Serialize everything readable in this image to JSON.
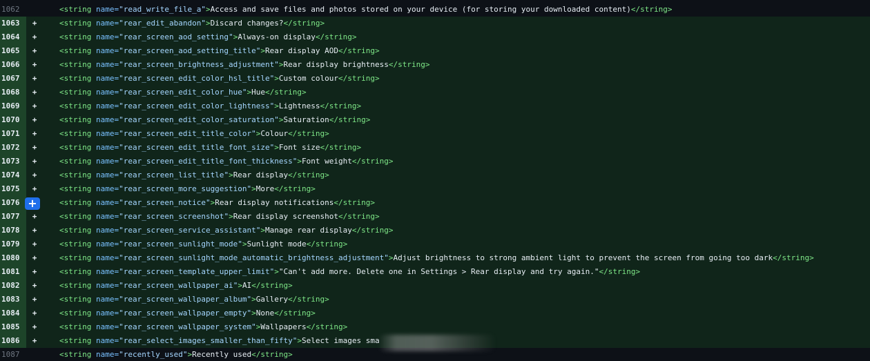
{
  "colors": {
    "background": "#0d1117",
    "added_row": "#10251a",
    "added_gutter": "#1d4429",
    "tag": "#7ee787",
    "attribute": "#79c0ff",
    "attribute_value": "#a5d6ff",
    "text": "#e6edf3",
    "expand_button": "#1f6feb"
  },
  "expand_button": {
    "label": "+",
    "icon": "plus-icon"
  },
  "lines": [
    {
      "num": "1062",
      "type": "context",
      "marker": "",
      "name": "read_write_file_a",
      "text": "Access and save files and photos stored on your device (for storing your downloaded content)"
    },
    {
      "num": "1063",
      "type": "added",
      "marker": "+",
      "name": "rear_edit_abandon",
      "text": "Discard changes?"
    },
    {
      "num": "1064",
      "type": "added",
      "marker": "+",
      "name": "rear_screen_aod_setting",
      "text": "Always-on display"
    },
    {
      "num": "1065",
      "type": "added",
      "marker": "+",
      "name": "rear_screen_aod_setting_title",
      "text": "Rear display AOD"
    },
    {
      "num": "1066",
      "type": "added",
      "marker": "+",
      "name": "rear_screen_brightness_adjustment",
      "text": "Rear display brightness"
    },
    {
      "num": "1067",
      "type": "added",
      "marker": "+",
      "name": "rear_screen_edit_color_hsl_title",
      "text": "Custom colour"
    },
    {
      "num": "1068",
      "type": "added",
      "marker": "+",
      "name": "rear_screen_edit_color_hue",
      "text": "Hue"
    },
    {
      "num": "1069",
      "type": "added",
      "marker": "+",
      "name": "rear_screen_edit_color_lightness",
      "text": "Lightness"
    },
    {
      "num": "1070",
      "type": "added",
      "marker": "+",
      "name": "rear_screen_edit_color_saturation",
      "text": "Saturation"
    },
    {
      "num": "1071",
      "type": "added",
      "marker": "+",
      "name": "rear_screen_edit_title_color",
      "text": "Colour"
    },
    {
      "num": "1072",
      "type": "added",
      "marker": "+",
      "name": "rear_screen_edit_title_font_size",
      "text": "Font size"
    },
    {
      "num": "1073",
      "type": "added",
      "marker": "+",
      "name": "rear_screen_edit_title_font_thickness",
      "text": "Font weight"
    },
    {
      "num": "1074",
      "type": "added",
      "marker": "+",
      "name": "rear_screen_list_title",
      "text": "Rear display"
    },
    {
      "num": "1075",
      "type": "added",
      "marker": "+",
      "name": "rear_screen_more_suggestion",
      "text": "More"
    },
    {
      "num": "1076",
      "type": "added",
      "marker": "",
      "name": "rear_screen_notice",
      "text": "Rear display notifications"
    },
    {
      "num": "1077",
      "type": "added",
      "marker": "+",
      "name": "rear_screen_screenshot",
      "text": "Rear display screenshot"
    },
    {
      "num": "1078",
      "type": "added",
      "marker": "+",
      "name": "rear_screen_service_assistant",
      "text": "Manage rear display"
    },
    {
      "num": "1079",
      "type": "added",
      "marker": "+",
      "name": "rear_screen_sunlight_mode",
      "text": "Sunlight mode"
    },
    {
      "num": "1080",
      "type": "added",
      "marker": "+",
      "name": "rear_screen_sunlight_mode_automatic_brightness_adjustment",
      "text": "Adjust brightness to strong ambient light to prevent the screen from going too dark"
    },
    {
      "num": "1081",
      "type": "added",
      "marker": "+",
      "name": "rear_screen_template_upper_limit",
      "text": "\"Can't add more. Delete one in Settings > Rear display and try again.\""
    },
    {
      "num": "1082",
      "type": "added",
      "marker": "+",
      "name": "rear_screen_wallpaper_ai",
      "text": "AI"
    },
    {
      "num": "1083",
      "type": "added",
      "marker": "+",
      "name": "rear_screen_wallpaper_album",
      "text": "Gallery"
    },
    {
      "num": "1084",
      "type": "added",
      "marker": "+",
      "name": "rear_screen_wallpaper_empty",
      "text": "None"
    },
    {
      "num": "1085",
      "type": "added",
      "marker": "+",
      "name": "rear_screen_wallpaper_system",
      "text": "Wallpapers"
    },
    {
      "num": "1086",
      "type": "added",
      "marker": "+",
      "name": "rear_select_images_smaller_than_fifty",
      "text": "Select images sma",
      "no_close": true
    },
    {
      "num": "1087",
      "type": "context",
      "marker": "",
      "name": "recently_used",
      "text": "Recently used"
    }
  ],
  "tokens": {
    "open_tag": "<string",
    "attr_name": " name=",
    "close_tag": "</string>",
    "tag_end": ">"
  }
}
